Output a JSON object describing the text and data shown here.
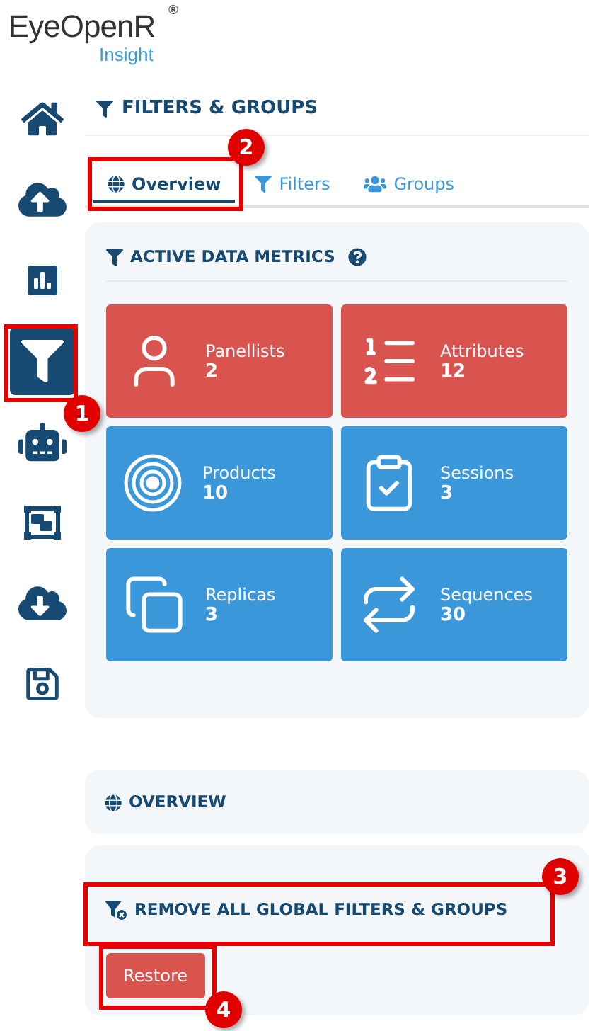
{
  "logo": {
    "name": "EyeOpenR",
    "mark": "®",
    "product": "Insight"
  },
  "sidebar": {
    "items": [
      {
        "selected": false
      },
      {
        "selected": false
      },
      {
        "selected": false
      },
      {
        "selected": true
      },
      {
        "selected": false
      },
      {
        "selected": false
      },
      {
        "selected": false
      },
      {
        "selected": false
      }
    ]
  },
  "page_title": "FILTERS & GROUPS",
  "tabs": [
    {
      "label": "Overview",
      "selected": true
    },
    {
      "label": "Filters",
      "selected": false
    },
    {
      "label": "Groups",
      "selected": false
    }
  ],
  "metrics_panel": {
    "title": "ACTIVE DATA METRICS",
    "cards": [
      {
        "label": "Panellists",
        "value": "2",
        "color": "#d9534f"
      },
      {
        "label": "Attributes",
        "value": "12",
        "color": "#d9534f"
      },
      {
        "label": "Products",
        "value": "10",
        "color": "#3a97d9"
      },
      {
        "label": "Sessions",
        "value": "3",
        "color": "#3a97d9"
      },
      {
        "label": "Replicas",
        "value": "3",
        "color": "#3a97d9"
      },
      {
        "label": "Sequences",
        "value": "30",
        "color": "#3a97d9"
      }
    ]
  },
  "overview_panel": {
    "title": "OVERVIEW"
  },
  "remove_panel": {
    "title": "REMOVE ALL GLOBAL FILTERS & GROUPS",
    "button": "Restore"
  },
  "annotations": [
    {
      "number": "1"
    },
    {
      "number": "2"
    },
    {
      "number": "3"
    },
    {
      "number": "4"
    }
  ]
}
